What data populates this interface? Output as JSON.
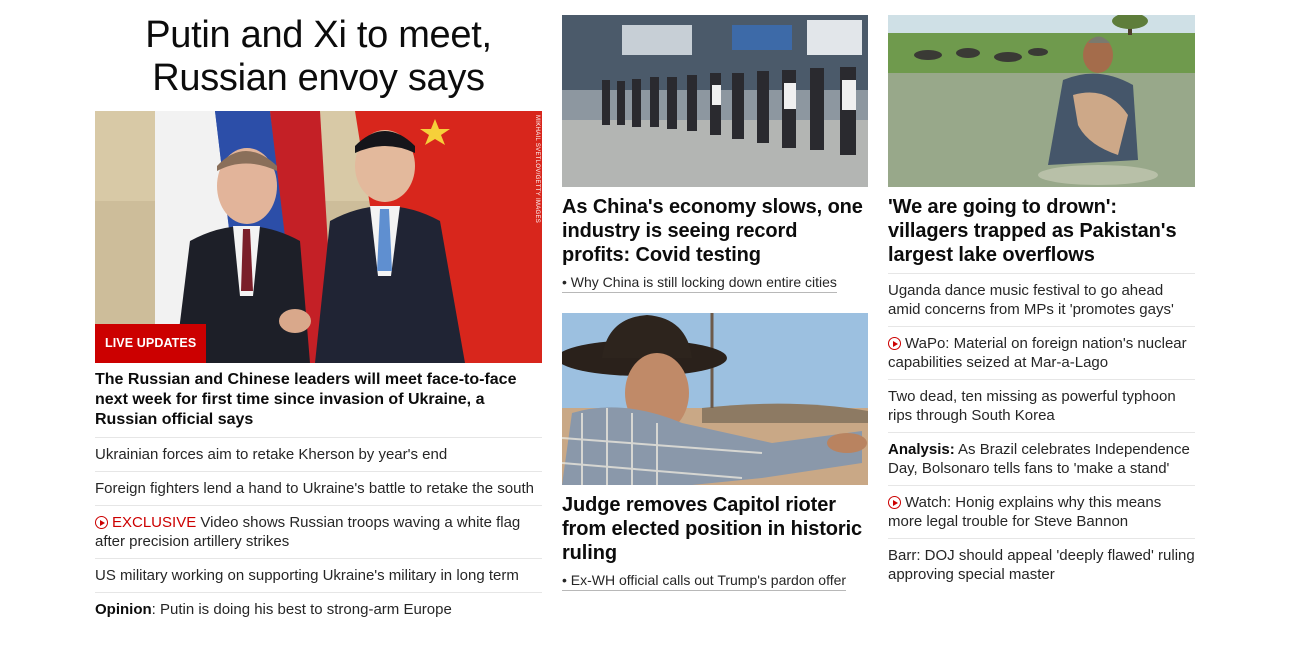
{
  "lead_story": {
    "headline": "Putin and Xi to meet, Russian envoy says",
    "badge": "LIVE UPDATES",
    "photo_credit": "MIKHAIL SVETLOV/GETTY IMAGES",
    "description": "The Russian and Chinese leaders will meet face-to-face next week for first time since invasion of Ukraine, a Russian official says",
    "related": [
      {
        "text": "Ukrainian forces aim to retake Kherson by year's end"
      },
      {
        "text": "Foreign fighters lend a hand to Ukraine's battle to retake the south"
      },
      {
        "prefix": "EXCLUSIVE",
        "text": "Video shows Russian troops waving a white flag after precision artillery strikes",
        "icon": "play-icon"
      },
      {
        "text": "US military working on supporting Ukraine's military in long term"
      },
      {
        "label": "Opinion",
        "text": ": Putin is doing his best to strong-arm Europe"
      }
    ]
  },
  "middle": {
    "story1": {
      "headline": "As China's economy slows, one industry is seeing record profits: Covid testing",
      "sublink": "• Why China is still locking down entire cities"
    },
    "story2": {
      "headline": "Judge removes Capitol rioter from elected position in historic ruling",
      "sublink": "• Ex-WH official calls out Trump's pardon offer"
    }
  },
  "right": {
    "story": {
      "headline": "'We are going to drown': villagers trapped as Pakistan's largest lake overflows"
    },
    "list": [
      {
        "text": "Uganda dance music festival to go ahead amid concerns from MPs it 'promotes gays'"
      },
      {
        "text": "WaPo: Material on foreign nation's nuclear capabilities seized at Mar-a-Lago",
        "icon": "play-icon"
      },
      {
        "text": "Two dead, ten missing as powerful typhoon rips through South Korea"
      },
      {
        "label": "Analysis:",
        "text": " As Brazil celebrates Independence Day, Bolsonaro tells fans to 'make a stand'"
      },
      {
        "text": "Watch: Honig explains why this means more legal trouble for Steve Bannon",
        "icon": "play-icon"
      },
      {
        "text": "Barr: DOJ should appeal 'deeply flawed' ruling approving special master"
      }
    ]
  },
  "colors": {
    "accent_red": "#cc0000",
    "text": "#0c0c0c",
    "divider": "#e6e6e6"
  }
}
